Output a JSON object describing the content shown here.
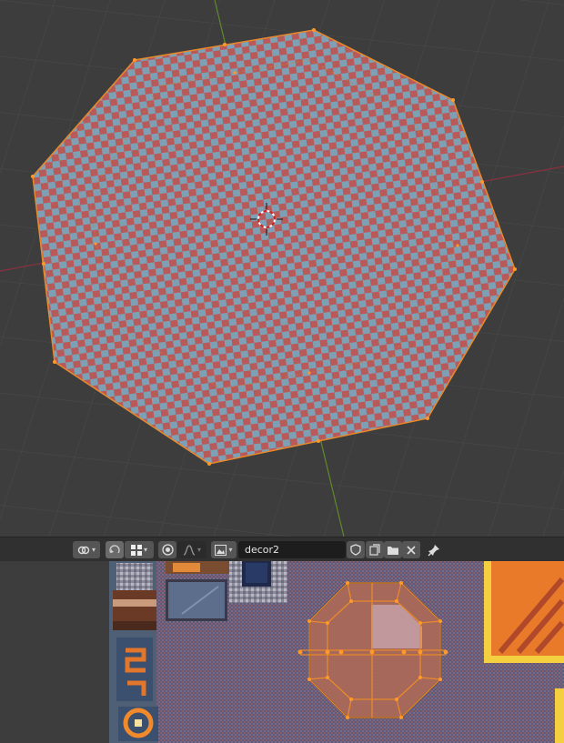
{
  "viewport": {
    "background": "#3d3d3d",
    "object": "octagon-plane",
    "checker_colors": [
      "#b85a5a",
      "#7ea0b4"
    ],
    "selection_color": "#e8892a"
  },
  "uv_header": {
    "image_name": "decor2",
    "icons": [
      "link-icon",
      "uv-sync-icon",
      "sticky-select-icon",
      "proportional-edit-icon",
      "falloff-curve-icon",
      "image-browse-icon",
      "fake-user-icon",
      "new-image-icon",
      "open-image-icon",
      "unlink-icon",
      "pin-icon"
    ]
  },
  "uv_editor": {
    "background": "#3d3d3d",
    "texture_name": "decor2"
  }
}
